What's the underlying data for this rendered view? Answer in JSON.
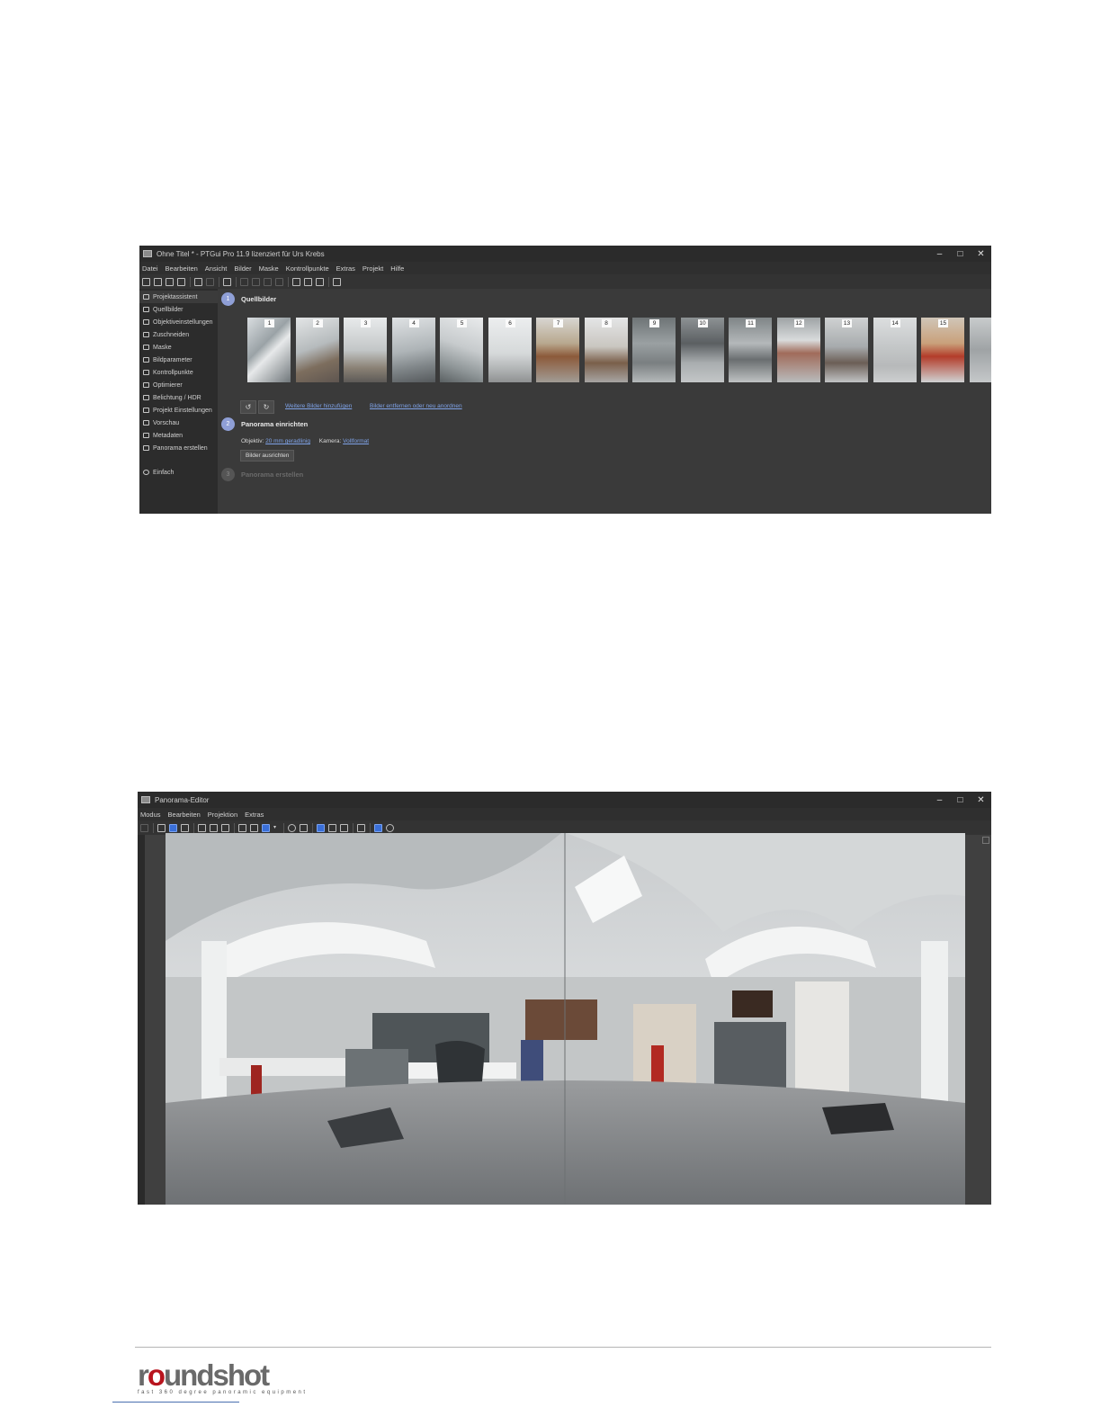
{
  "window1": {
    "title": "Ohne Titel * - PTGui Pro 11.9 lizenziert für Urs Krebs",
    "menu": [
      "Datei",
      "Bearbeiten",
      "Ansicht",
      "Bilder",
      "Maske",
      "Kontrollpunkte",
      "Extras",
      "Projekt",
      "Hilfe"
    ],
    "sidebar": [
      {
        "label": "Projektassistent",
        "icon": "home-icon",
        "active": true
      },
      {
        "label": "Quellbilder",
        "icon": "images-icon"
      },
      {
        "label": "Objektiveinstellungen",
        "icon": "lens-icon"
      },
      {
        "label": "Zuschneiden",
        "icon": "crop-icon"
      },
      {
        "label": "Maske",
        "icon": "brush-icon"
      },
      {
        "label": "Bildparameter",
        "icon": "sliders-icon"
      },
      {
        "label": "Kontrollpunkte",
        "icon": "control-points-icon"
      },
      {
        "label": "Optimierer",
        "icon": "optimizer-icon"
      },
      {
        "label": "Belichtung / HDR",
        "icon": "sun-icon"
      },
      {
        "label": "Projekt Einstellungen",
        "icon": "gear-icon"
      },
      {
        "label": "Vorschau",
        "icon": "eye-icon"
      },
      {
        "label": "Metadaten",
        "icon": "info-icon"
      },
      {
        "label": "Panorama erstellen",
        "icon": "panorama-icon"
      }
    ],
    "sidebar_bottom": {
      "label": "Einfach",
      "icon": "circle-chevron-up-icon"
    },
    "step1": {
      "number": "1",
      "title": "Quellbilder"
    },
    "thumbnails": [
      "1",
      "2",
      "3",
      "4",
      "5",
      "6",
      "7",
      "8",
      "9",
      "10",
      "11",
      "12",
      "13",
      "14",
      "15"
    ],
    "add_images_link": "Weitere Bilder hinzufügen",
    "remove_reorder_link": "Bilder entfernen oder neu anordnen",
    "step2": {
      "number": "2",
      "title": "Panorama einrichten"
    },
    "lens_label": "Objektiv:",
    "lens_value": "20 mm geradlinig",
    "camera_label": "Kamera:",
    "camera_value": "Vollformat",
    "align_button": "Bilder ausrichten",
    "step3": {
      "number": "3",
      "title": "Panorama erstellen"
    }
  },
  "window2": {
    "title": "Panorama-Editor",
    "menu": [
      "Modus",
      "Bearbeiten",
      "Projektion",
      "Extras"
    ]
  },
  "footer": {
    "logo_pre": "r",
    "logo_red": "o",
    "logo_post": "undshot",
    "tagline": "fast 360 degree panoramic equipment"
  }
}
